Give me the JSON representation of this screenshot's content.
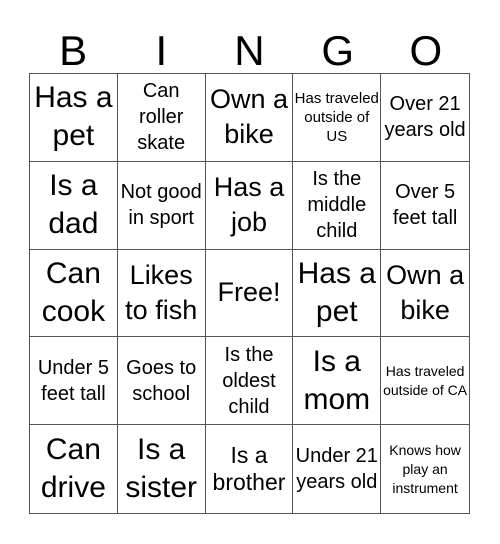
{
  "header": {
    "letters": [
      "B",
      "I",
      "N",
      "G",
      "O"
    ]
  },
  "cells": [
    "Has a pet",
    "Can roller skate",
    "Own a bike",
    "Has traveled outside of US",
    "Over 21 years old",
    "Is a dad",
    "Not good in sport",
    "Has a job",
    "Is the middle child",
    "Over 5 feet tall",
    "Can cook",
    "Likes to fish",
    "Free!",
    "Has a pet",
    "Own a bike",
    "Under 5 feet tall",
    "Goes to school",
    "Is the oldest child",
    "Is a mom",
    "Has traveled outside of CA",
    "Can drive",
    "Is a sister",
    "Is a brother",
    "Under 21 years old",
    "Knows how play an instrument"
  ]
}
